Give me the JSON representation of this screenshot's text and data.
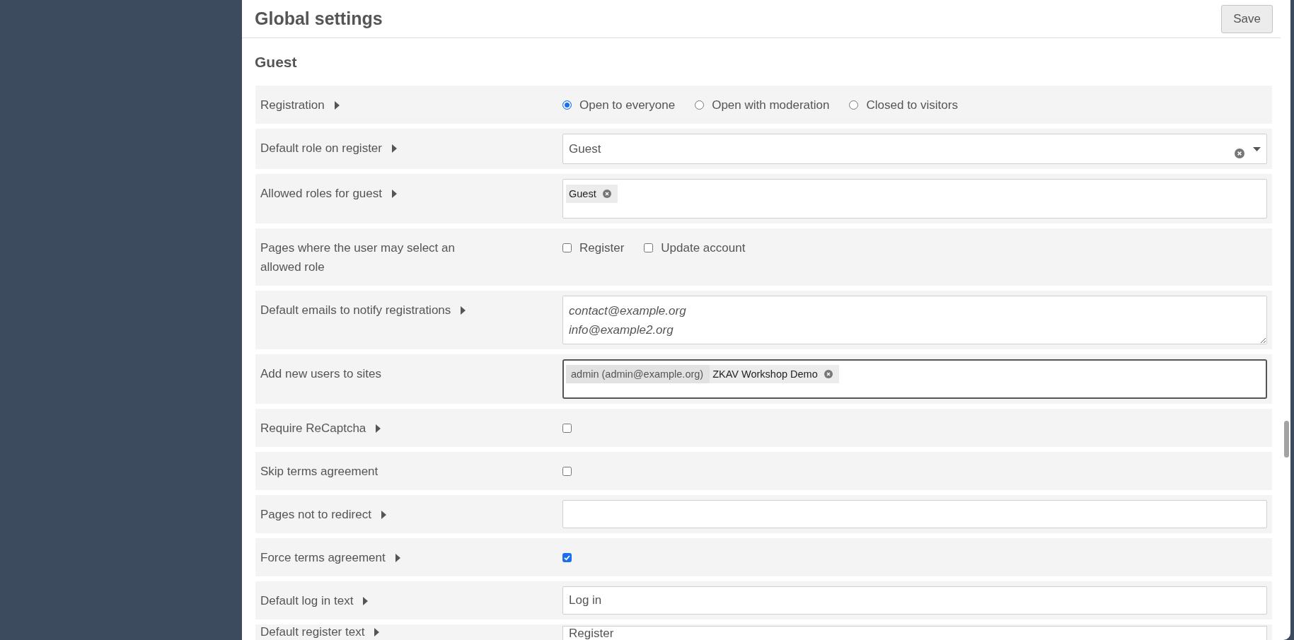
{
  "header": {
    "title": "Global settings",
    "save_button": "Save"
  },
  "section": {
    "title": "Guest"
  },
  "rows": [
    {
      "label": "Registration",
      "info": true,
      "kind": "radio",
      "options": [
        {
          "label": "Open to everyone",
          "selected": true
        },
        {
          "label": "Open with moderation",
          "selected": false
        },
        {
          "label": "Closed to visitors",
          "selected": false
        }
      ]
    },
    {
      "label": "Default role on register",
      "info": true,
      "kind": "select",
      "value": "Guest"
    },
    {
      "label": "Allowed roles for guest",
      "info": true,
      "kind": "tags",
      "focused": false,
      "tags": [
        {
          "label": "Guest",
          "kind": "tag"
        }
      ]
    },
    {
      "label": "Pages where the user may select an allowed role",
      "info": false,
      "kind": "checkboxes",
      "options": [
        {
          "label": "Register",
          "checked": false
        },
        {
          "label": "Update account",
          "checked": false
        }
      ]
    },
    {
      "label": "Default emails to notify registrations",
      "info": true,
      "kind": "textarea",
      "placeholder": "contact@example.org\ninfo@example2.org"
    },
    {
      "label": "Add new users to sites",
      "info": false,
      "kind": "tags",
      "focused": true,
      "tags": [
        {
          "label": "admin (admin@example.org)",
          "kind": "group"
        },
        {
          "label": "ZKAV Workshop Demo",
          "kind": "tag"
        }
      ]
    },
    {
      "label": "Require ReCaptcha",
      "info": true,
      "kind": "checkbox",
      "checked": false
    },
    {
      "label": "Skip terms agreement",
      "info": false,
      "kind": "checkbox",
      "checked": false
    },
    {
      "label": "Pages not to redirect",
      "info": true,
      "kind": "text"
    },
    {
      "label": "Force terms agreement",
      "info": true,
      "kind": "checkbox",
      "checked": true
    },
    {
      "label": "Default log in text",
      "info": true,
      "kind": "text",
      "value": "Log in"
    },
    {
      "label": "Default register text",
      "info": true,
      "kind": "text",
      "value": "Register"
    }
  ]
}
